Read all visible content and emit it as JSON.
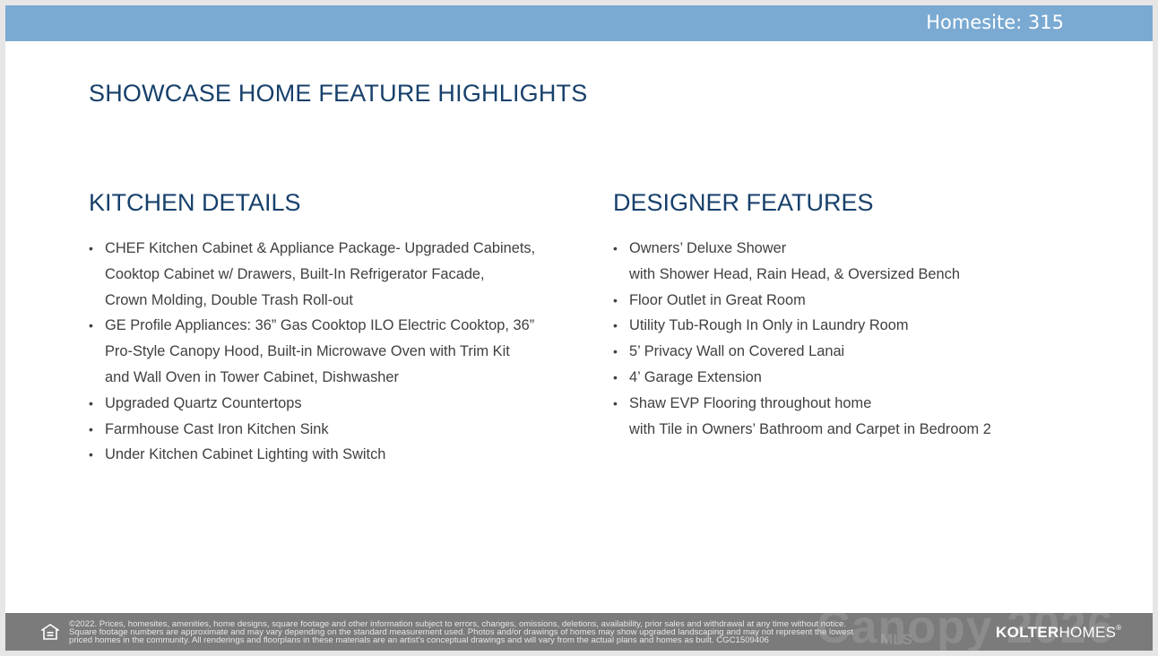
{
  "header": {
    "homesite": "Homesite: 315"
  },
  "title": "SHOWCASE HOME FEATURE HIGHLIGHTS",
  "kitchen": {
    "heading": "KITCHEN DETAILS",
    "bullet": "•",
    "items": [
      [
        "CHEF Kitchen Cabinet & Appliance Package- Upgraded Cabinets,",
        "Cooktop Cabinet w/ Drawers, Built-In Refrigerator Facade,",
        "Crown Molding, Double Trash Roll-out"
      ],
      [
        "GE Profile Appliances: 36” Gas Cooktop ILO Electric Cooktop, 36”",
        "Pro-Style Canopy Hood, Built-in Microwave Oven with Trim Kit",
        "and Wall Oven in Tower Cabinet, Dishwasher"
      ],
      [
        "Upgraded Quartz Countertops"
      ],
      [
        "Farmhouse Cast Iron Kitchen Sink"
      ],
      [
        "Under Kitchen Cabinet Lighting with Switch"
      ]
    ]
  },
  "designer": {
    "heading": "DESIGNER FEATURES",
    "bullet": "•",
    "items": [
      [
        "Owners’ Deluxe Shower",
        "with Shower Head, Rain Head, & Oversized Bench"
      ],
      [
        "Floor Outlet in Great Room"
      ],
      [
        "Utility Tub-Rough In Only in Laundry Room"
      ],
      [
        "5’ Privacy Wall on Covered Lanai"
      ],
      [
        "4’ Garage Extension"
      ],
      [
        "Shaw EVP Flooring throughout home",
        "with Tile in Owners’ Bathroom and Carpet in Bedroom 2"
      ]
    ]
  },
  "footer": {
    "icon": "equal-housing-icon",
    "disclaimer": [
      "©2022. Prices, homesites, amenities, home designs, square footage and other information subject to errors, changes, omissions, deletions, availability, prior sales and withdrawal at any time without notice.",
      "Square footage numbers are approximate and may vary depending on the standard measurement used. Photos and/or drawings of homes may show upgraded landscaping and may not represent the lowest",
      "priced homes in the community. All renderings and floorplans in these materials are an artist’s conceptual drawings and will vary from the actual plans and homes as built. CGC1509406"
    ],
    "watermark": "Canopy 2026",
    "watermark_sub": "MLS",
    "logo_bold": "KOLTER",
    "logo_light": "HOMES",
    "logo_mark": "®"
  }
}
